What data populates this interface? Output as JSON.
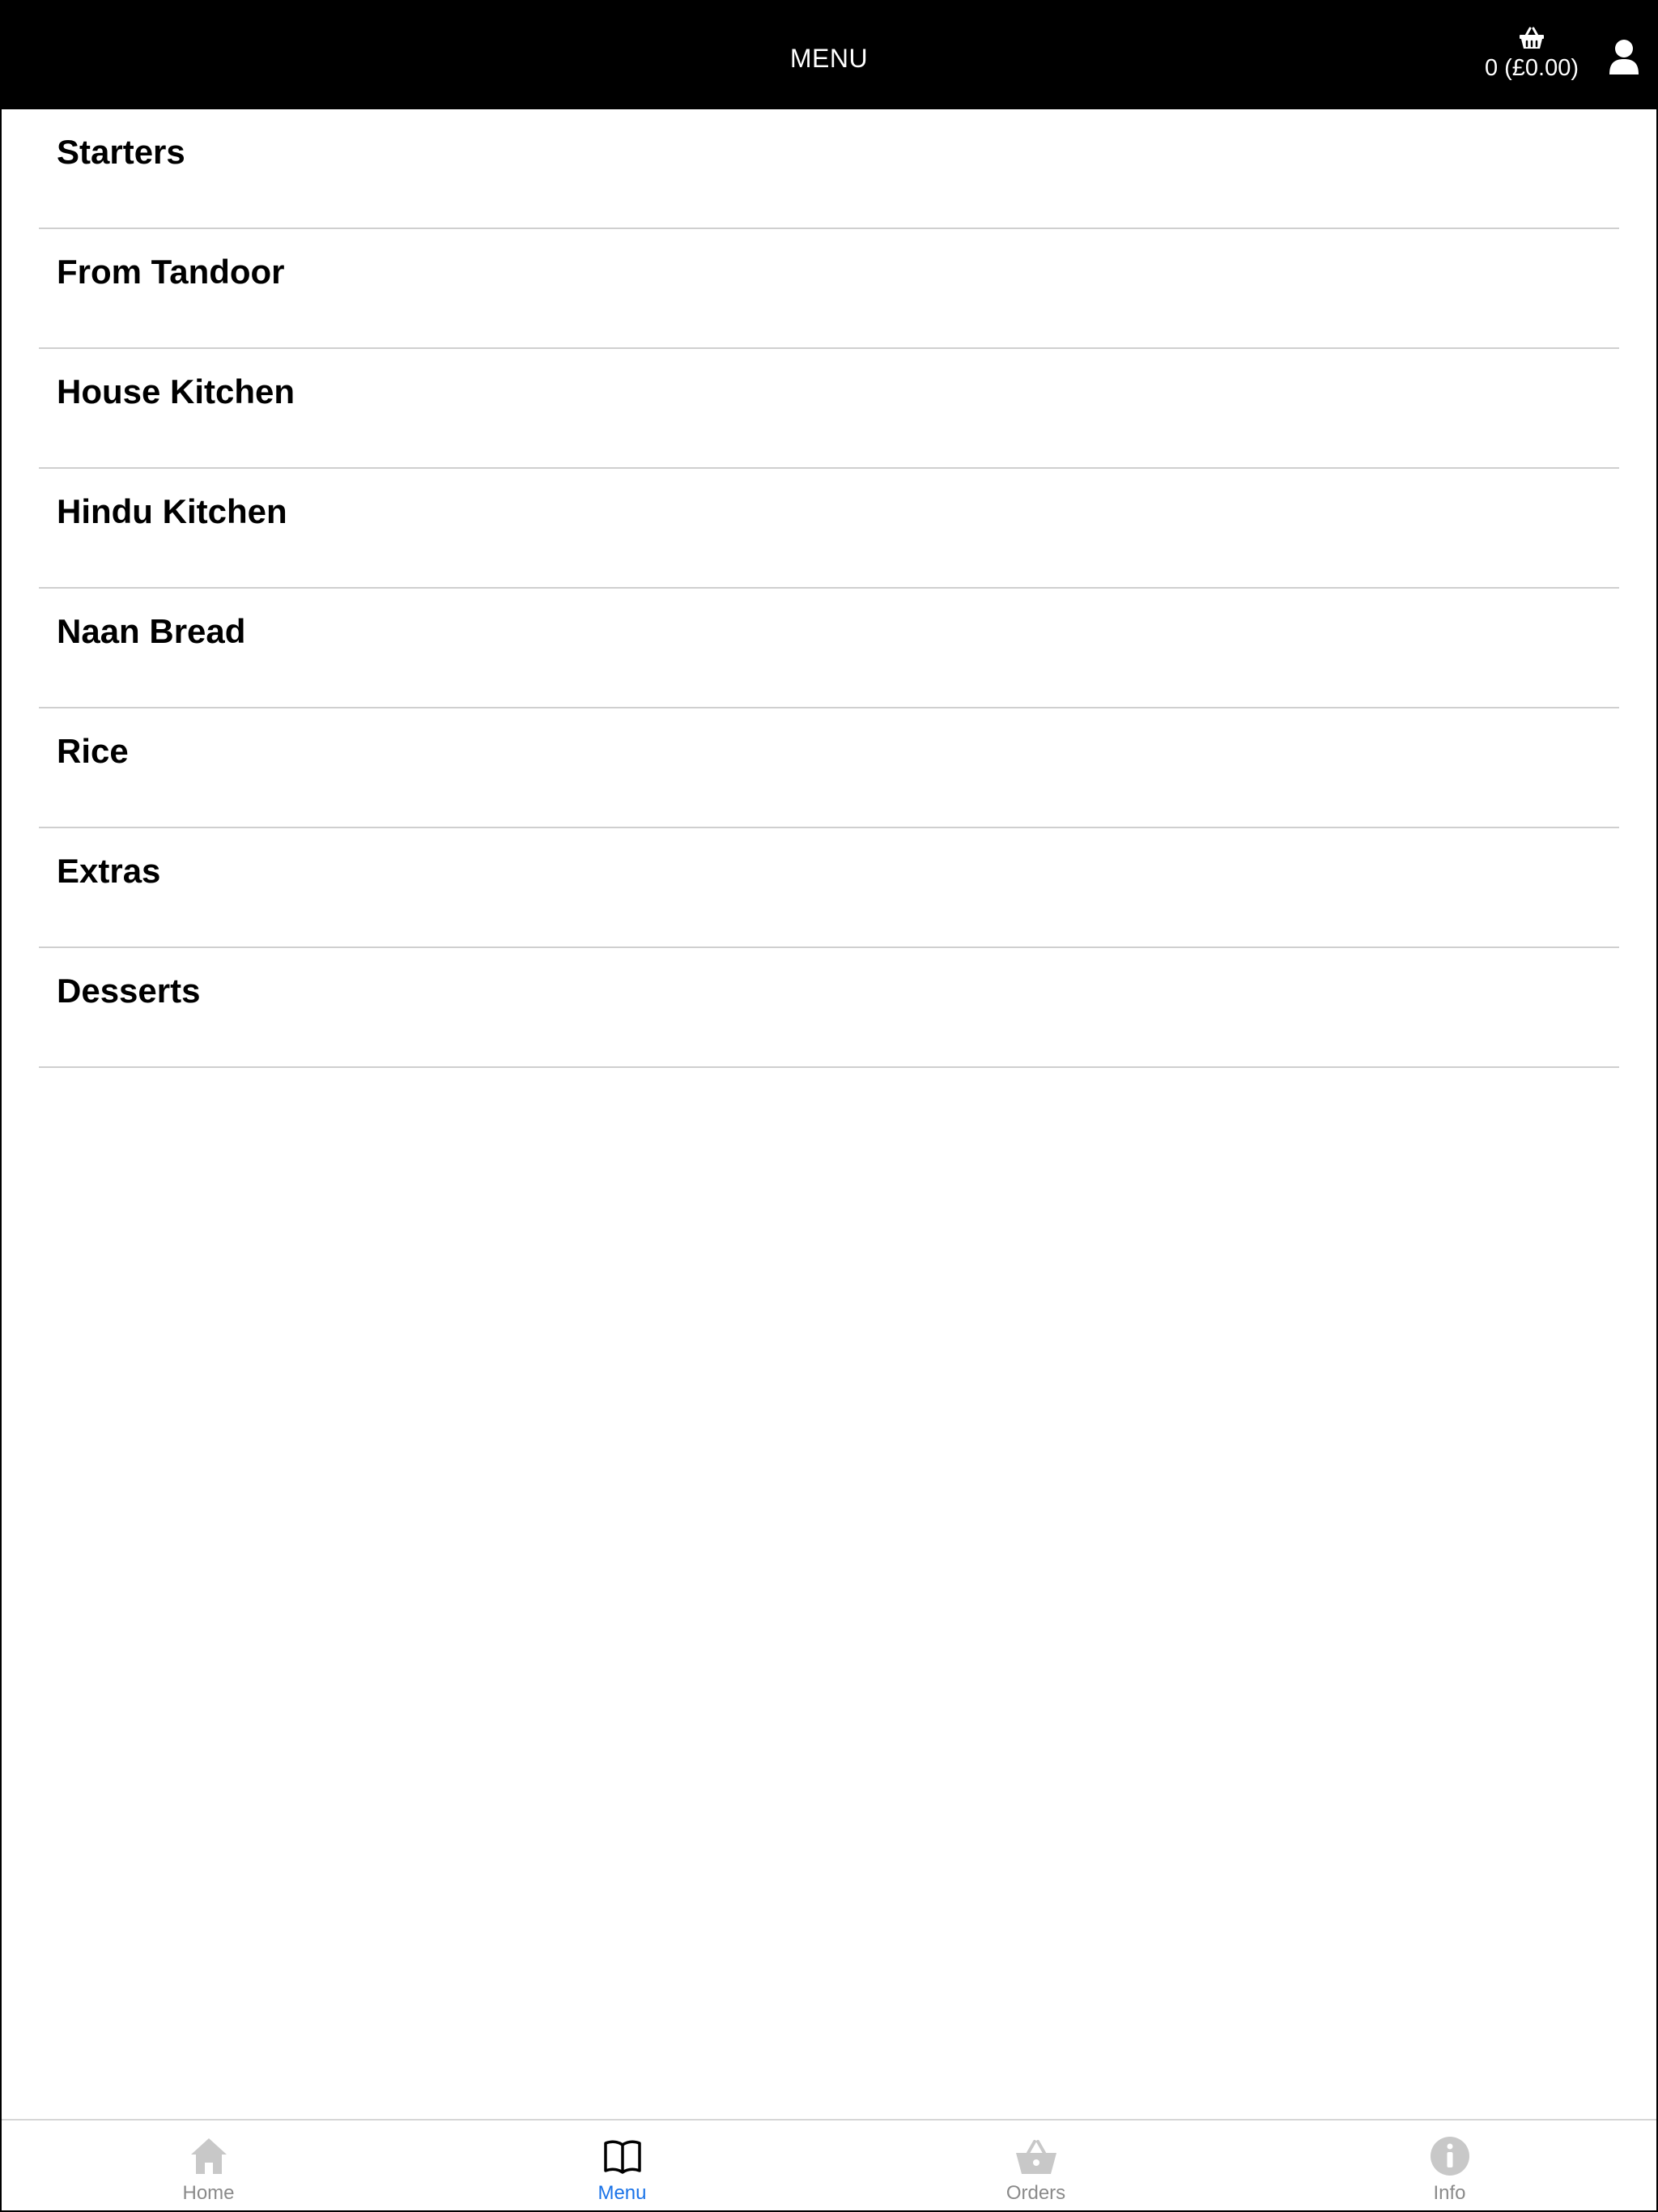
{
  "header": {
    "title": "MENU",
    "cart_text": "0 (£0.00)"
  },
  "categories": [
    {
      "label": "Starters"
    },
    {
      "label": "From Tandoor"
    },
    {
      "label": "House Kitchen"
    },
    {
      "label": "Hindu Kitchen"
    },
    {
      "label": "Naan Bread"
    },
    {
      "label": "Rice"
    },
    {
      "label": "Extras"
    },
    {
      "label": "Desserts"
    }
  ],
  "tabs": [
    {
      "label": "Home",
      "icon": "home-icon",
      "active": false
    },
    {
      "label": "Menu",
      "icon": "book-icon",
      "active": true
    },
    {
      "label": "Orders",
      "icon": "basket-icon",
      "active": false
    },
    {
      "label": "Info",
      "icon": "info-icon",
      "active": false
    }
  ],
  "colors": {
    "header_bg": "#000000",
    "active_tab": "#1a73e8",
    "inactive_tab": "#8a8a8a",
    "divider": "#cfcfcf"
  }
}
